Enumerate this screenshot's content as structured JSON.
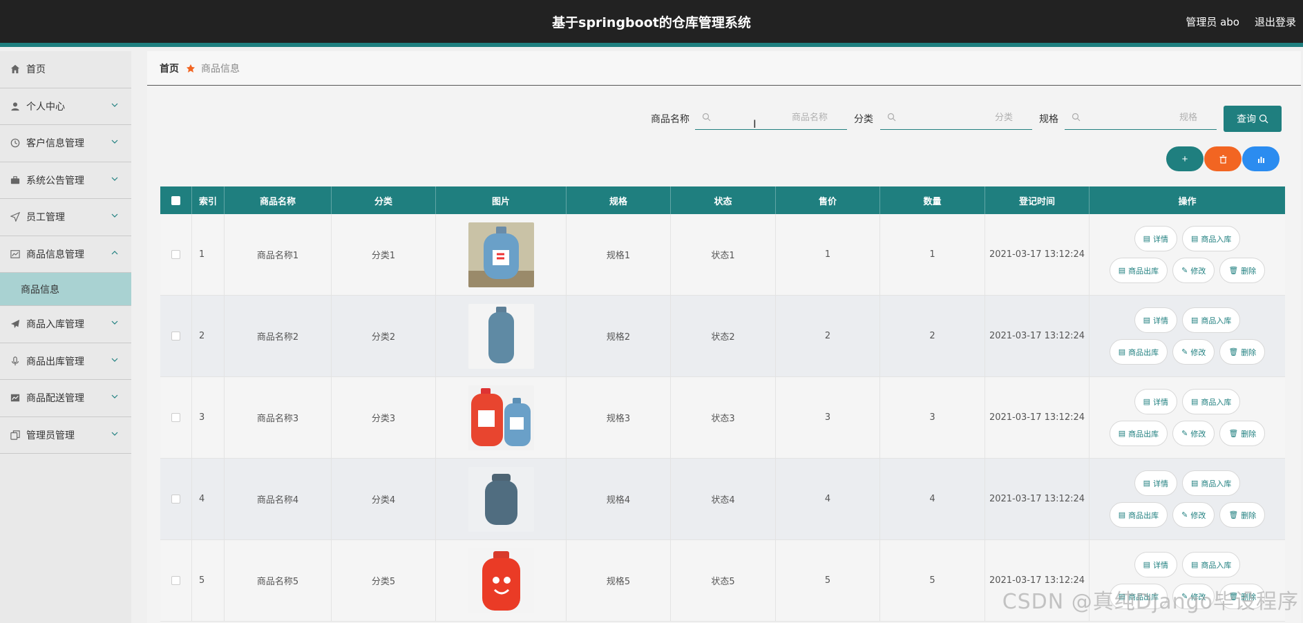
{
  "header": {
    "title": "基于springboot的仓库管理系统",
    "user": "管理员 abo",
    "logout": "退出登录"
  },
  "sidebar": {
    "items": [
      {
        "label": "首页",
        "icon": "home-icon",
        "expandable": false
      },
      {
        "label": "个人中心",
        "icon": "person-icon",
        "expandable": true
      },
      {
        "label": "客户信息管理",
        "icon": "clock-icon",
        "expandable": true
      },
      {
        "label": "系统公告管理",
        "icon": "briefcase-icon",
        "expandable": true
      },
      {
        "label": "员工管理",
        "icon": "send-icon",
        "expandable": true
      },
      {
        "label": "商品信息管理",
        "icon": "chart-icon",
        "expandable": true,
        "expanded": true
      },
      {
        "label": "商品入库管理",
        "icon": "paper-plane-icon",
        "expandable": true
      },
      {
        "label": "商品出库管理",
        "icon": "microphone-icon",
        "expandable": true
      },
      {
        "label": "商品配送管理",
        "icon": "trend-icon",
        "expandable": true
      },
      {
        "label": "管理员管理",
        "icon": "copy-icon",
        "expandable": true
      }
    ],
    "active_sub": "商品信息"
  },
  "breadcrumb": {
    "home": "首页",
    "current": "商品信息"
  },
  "search": {
    "name_label": "商品名称",
    "name_placeholder": "商品名称",
    "category_label": "分类",
    "category_placeholder": "分类",
    "spec_label": "规格",
    "spec_placeholder": "规格",
    "query_button": "查询"
  },
  "actions": {
    "add": "+",
    "colors": {
      "add": "#1f7f7f",
      "delete": "#f26522",
      "stats": "#2b8cf0"
    }
  },
  "table": {
    "columns": [
      "索引",
      "商品名称",
      "分类",
      "图片",
      "规格",
      "状态",
      "售价",
      "数量",
      "登记时间",
      "操作"
    ],
    "rows": [
      {
        "index": "1",
        "name": "商品名称1",
        "category": "分类1",
        "image": "blue-gas-cylinder",
        "spec": "规格1",
        "status": "状态1",
        "price": "1",
        "qty": "1",
        "time": "2021-03-17 13:12:24"
      },
      {
        "index": "2",
        "name": "商品名称2",
        "category": "分类2",
        "image": "grey-blue-gas-cylinder",
        "spec": "规格2",
        "status": "状态2",
        "price": "2",
        "qty": "2",
        "time": "2021-03-17 13:12:24"
      },
      {
        "index": "3",
        "name": "商品名称3",
        "category": "分类3",
        "image": "red-and-blue-gas-cylinders",
        "spec": "规格3",
        "status": "状态3",
        "price": "3",
        "qty": "3",
        "time": "2021-03-17 13:12:24"
      },
      {
        "index": "4",
        "name": "商品名称4",
        "category": "分类4",
        "image": "dark-gas-cylinder",
        "spec": "规格4",
        "status": "状态4",
        "price": "4",
        "qty": "4",
        "time": "2021-03-17 13:12:24"
      },
      {
        "index": "5",
        "name": "商品名称5",
        "category": "分类5",
        "image": "red-gas-cylinder",
        "spec": "规格5",
        "status": "状态5",
        "price": "5",
        "qty": "5",
        "time": "2021-03-17 13:12:24"
      }
    ],
    "ops": {
      "detail": "详情",
      "stock_in": "商品入库",
      "stock_out": "商品出库",
      "edit": "修改",
      "delete": "删除"
    }
  },
  "watermark": "CSDN @真纯Django毕设程序",
  "colors": {
    "theme": "#1f7f7f",
    "header_bg": "#222222",
    "sidebar_active": "#a9d2d2"
  }
}
